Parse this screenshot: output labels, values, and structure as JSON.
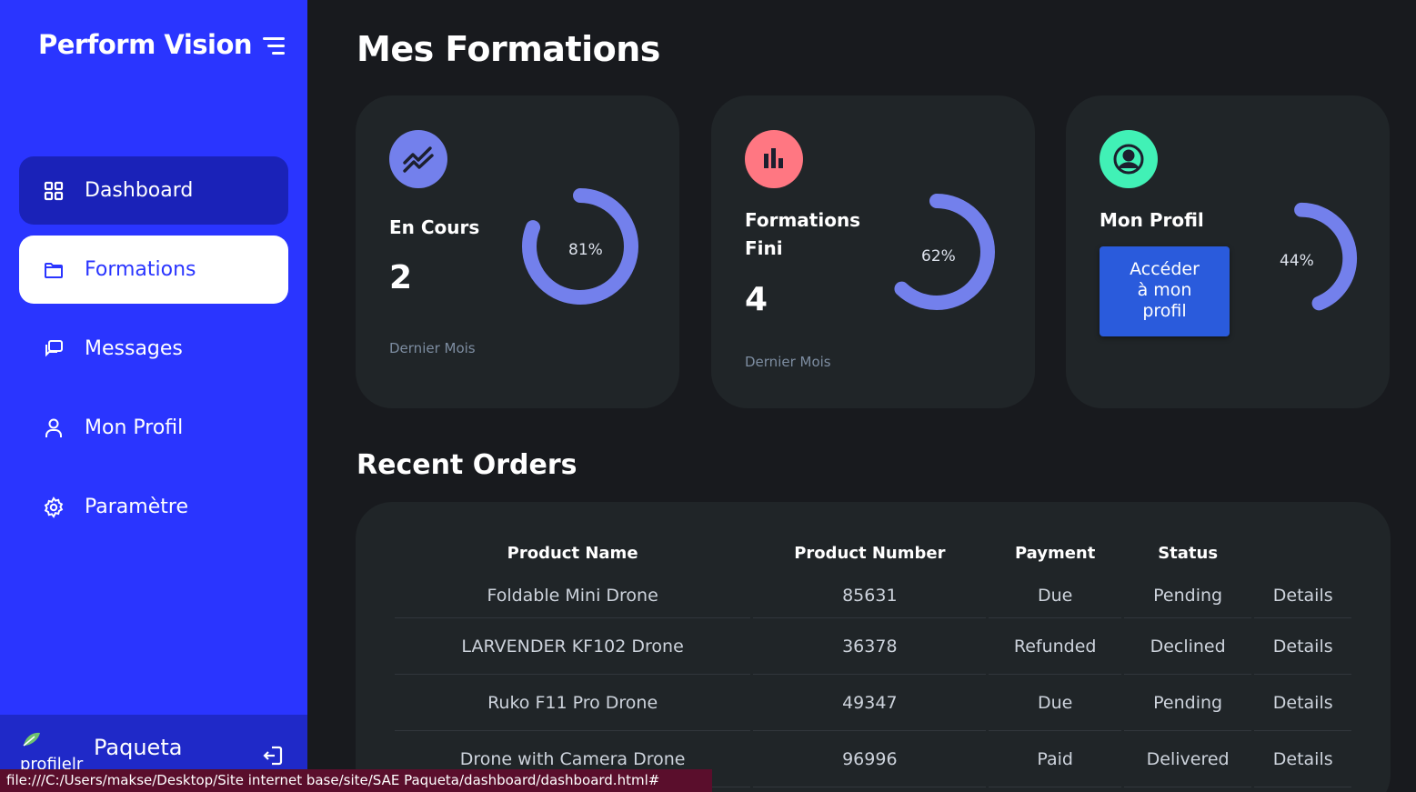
{
  "sidebar": {
    "brand": "Perform Vision",
    "items": [
      {
        "label": "Dashboard",
        "icon": "grid-icon"
      },
      {
        "label": "Formations",
        "icon": "folder-icon"
      },
      {
        "label": "Messages",
        "icon": "messages-icon"
      },
      {
        "label": "Mon Profil",
        "icon": "user-icon"
      },
      {
        "label": "Paramètre",
        "icon": "gear-icon"
      }
    ],
    "user": {
      "avatar_alt": "profilelr",
      "name": "Paqueta"
    }
  },
  "main": {
    "title": "Mes Formations",
    "cards": [
      {
        "title": "En Cours",
        "value": "2",
        "sub": "Dernier Mois",
        "percent": "81%",
        "fraction": 0.81,
        "color": "#7380ec"
      },
      {
        "title_line1": "Formations",
        "title_line2": "Fini",
        "value": "4",
        "sub": "Dernier Mois",
        "percent": "62%",
        "fraction": 0.62,
        "color": "#ff7782"
      },
      {
        "title": "Mon Profil",
        "button_line1": "Accéder",
        "button_line2": "à mon",
        "button_line3": "profil",
        "percent": "44%",
        "fraction": 0.44,
        "color": "#41f1b6"
      }
    ],
    "orders": {
      "title": "Recent Orders",
      "headers": [
        "Product Name",
        "Product Number",
        "Payment",
        "Status",
        ""
      ],
      "rows": [
        {
          "name": "Foldable Mini Drone",
          "number": "85631",
          "payment": "Due",
          "status": "Pending",
          "action": "Details"
        },
        {
          "name": "LARVENDER KF102 Drone",
          "number": "36378",
          "payment": "Refunded",
          "status": "Declined",
          "action": "Details"
        },
        {
          "name": "Ruko F11 Pro Drone",
          "number": "49347",
          "payment": "Due",
          "status": "Pending",
          "action": "Details"
        },
        {
          "name": "Drone with Camera Drone",
          "number": "96996",
          "payment": "Paid",
          "status": "Delivered",
          "action": "Details"
        }
      ]
    }
  },
  "statusbar": {
    "url": "file:///C:/Users/makse/Desktop/Site internet base/site/SAE Paqueta/dashboard/dashboard.html#"
  },
  "colors": {
    "sidebar": "#2a35ff",
    "primary": "#7380ec",
    "danger": "#ff7782",
    "success": "#41f1b6",
    "background": "#181a1e",
    "card": "#202528",
    "button": "#2a5bdc"
  }
}
